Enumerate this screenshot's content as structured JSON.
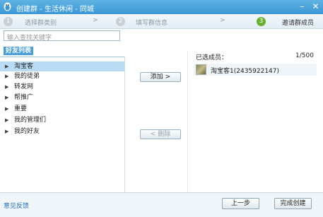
{
  "window": {
    "title": "创建群 - 生活休闲 - 同城",
    "min_icon": "minimize-icon",
    "close_icon": "close-icon",
    "logo_icon": "qq-penguin-icon"
  },
  "steps": [
    {
      "num": "1",
      "label": "选择群类别"
    },
    {
      "num": "2",
      "label": "填写群信息"
    },
    {
      "num": "3",
      "label": "邀请群成员"
    }
  ],
  "step_arrow": ">",
  "search": {
    "placeholder": "输入查找关键字"
  },
  "friend_list": {
    "tab_label": "好友列表",
    "groups": [
      "淘宝客",
      "我的徒弟",
      "转发网",
      "帮推广",
      "重要",
      "我的管理们",
      "我的好友"
    ],
    "selected_index": 0
  },
  "actions": {
    "add": "添加 >",
    "remove": "< 删除"
  },
  "selected": {
    "header": "已选成员：",
    "count": "1/500",
    "members": [
      {
        "name": "淘宝客1(2435922147)"
      }
    ]
  },
  "footer": {
    "feedback": "意见反馈",
    "prev": "上一步",
    "finish": "完成创建"
  },
  "colors": {
    "titlebar": "#3a97d6",
    "selection": "#b9dcf4",
    "active_step": "#6aae2e",
    "link": "#1f6fb8"
  }
}
